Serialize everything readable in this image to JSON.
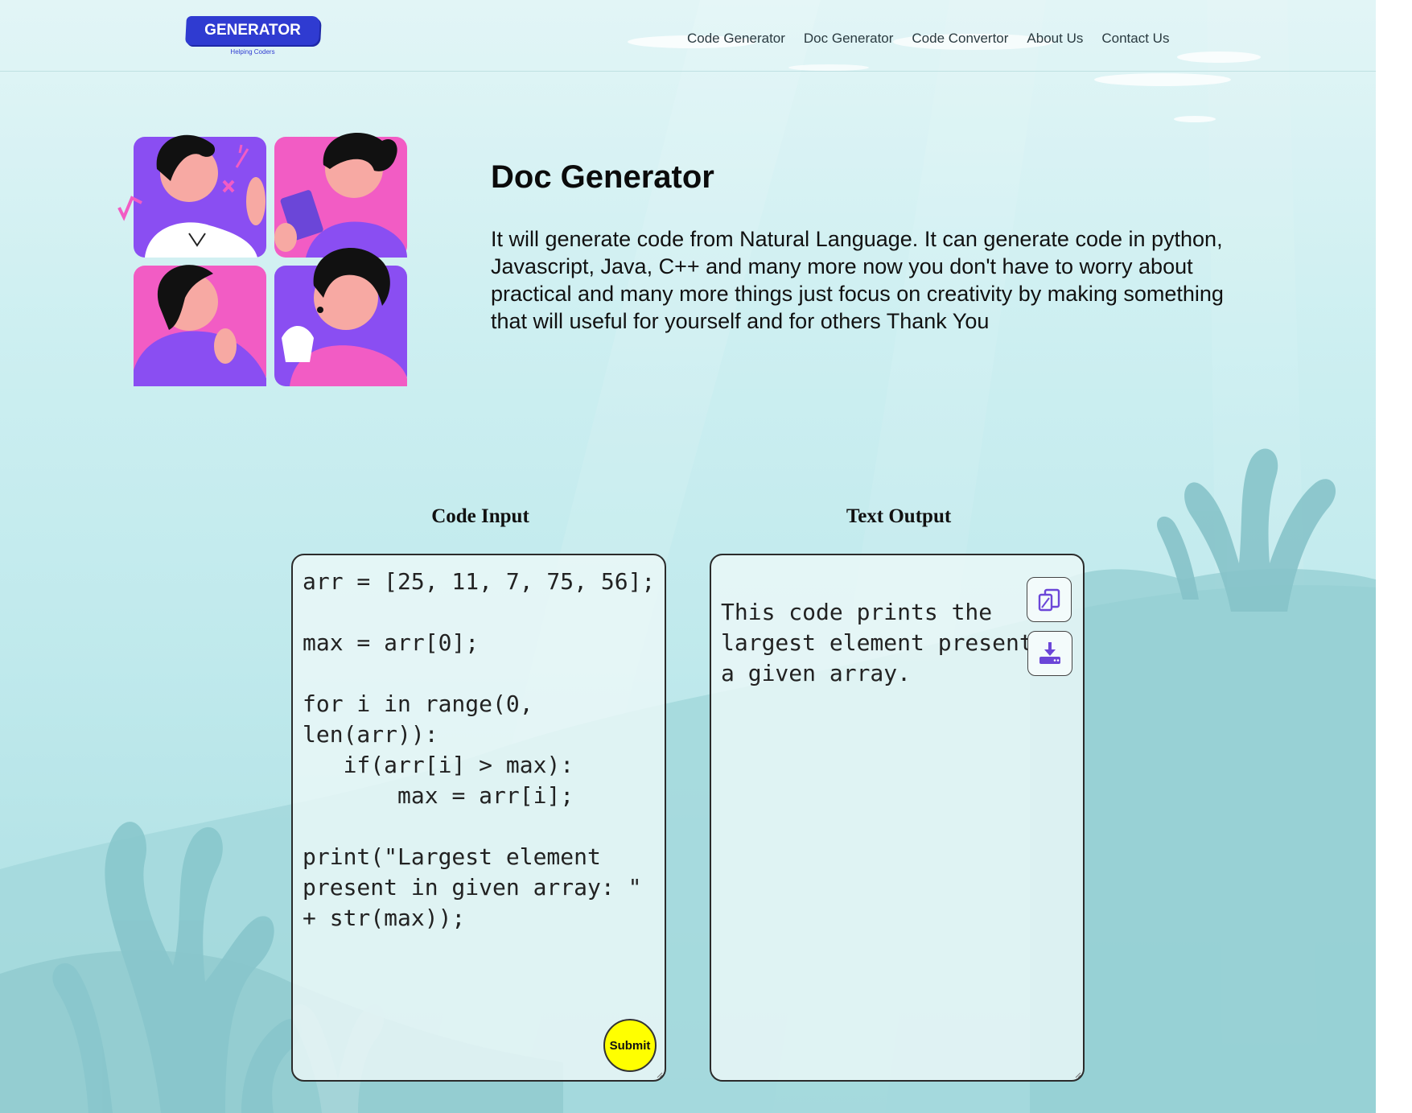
{
  "header": {
    "logo": {
      "text": "GENERATOR",
      "tagline": "Helping Coders"
    },
    "nav": [
      "Code Generator",
      "Doc Generator",
      "Code Convertor",
      "About Us",
      "Contact Us"
    ]
  },
  "hero": {
    "title": "Doc Generator",
    "description": "It will generate code from Natural Language. It can generate code in python, Javascript, Java, C++ and many more now you don't have to worry about practical and many more things just focus on creativity by making something that will useful for yourself and for others Thank You"
  },
  "input_panel": {
    "title": "Code Input",
    "value": "arr = [25, 11, 7, 75, 56];\n\nmax = arr[0];\n\nfor i in range(0, len(arr)):\n   if(arr[i] > max):\n       max = arr[i];\n\nprint(\"Largest element present in given array: \" + str(max));",
    "submit_label": "Submit"
  },
  "output_panel": {
    "title": "Text Output",
    "value": "This code prints the largest element present in a given array.",
    "icons": [
      "copy-icon",
      "download-icon"
    ]
  },
  "colors": {
    "logo_blue": "#2f3bd1",
    "submit_yellow": "#ffff00",
    "icon_purple": "#6b46d8",
    "pink": "#f25cc4",
    "purple": "#8a4ef2"
  }
}
